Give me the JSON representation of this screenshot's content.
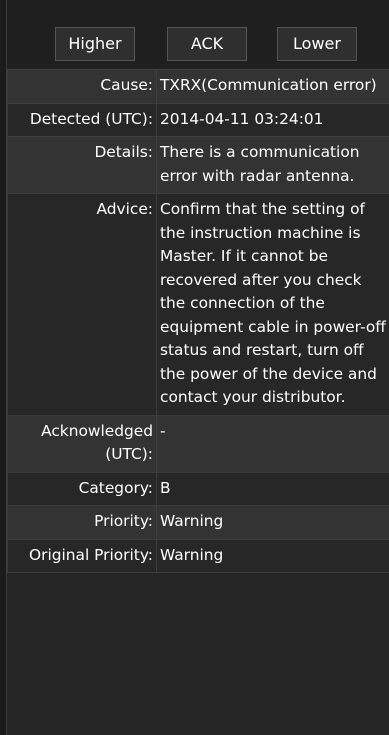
{
  "buttons": {
    "higher": "Higher",
    "ack": "ACK",
    "lower": "Lower"
  },
  "rows": {
    "cause": {
      "label": "Cause:",
      "value": "TXRX(Communication error)"
    },
    "detected": {
      "label": "Detected (UTC):",
      "value": "2014-04-11 03:24:01"
    },
    "details": {
      "label": "Details:",
      "value": "There is a communication error with radar antenna."
    },
    "advice": {
      "label": "Advice:",
      "value": "Confirm that the setting of the instruction machine is Master. If it cannot be recovered after you check the connection of the equipment cable in power-off status and restart, turn off the power of the device and contact your distributor."
    },
    "acknowledged": {
      "label": "Acknowledged (UTC):",
      "value": "-"
    },
    "category": {
      "label": "Category:",
      "value": "B"
    },
    "priority": {
      "label": "Priority:",
      "value": "Warning"
    },
    "original_priority": {
      "label": "Original Priority:",
      "value": "Warning"
    }
  }
}
